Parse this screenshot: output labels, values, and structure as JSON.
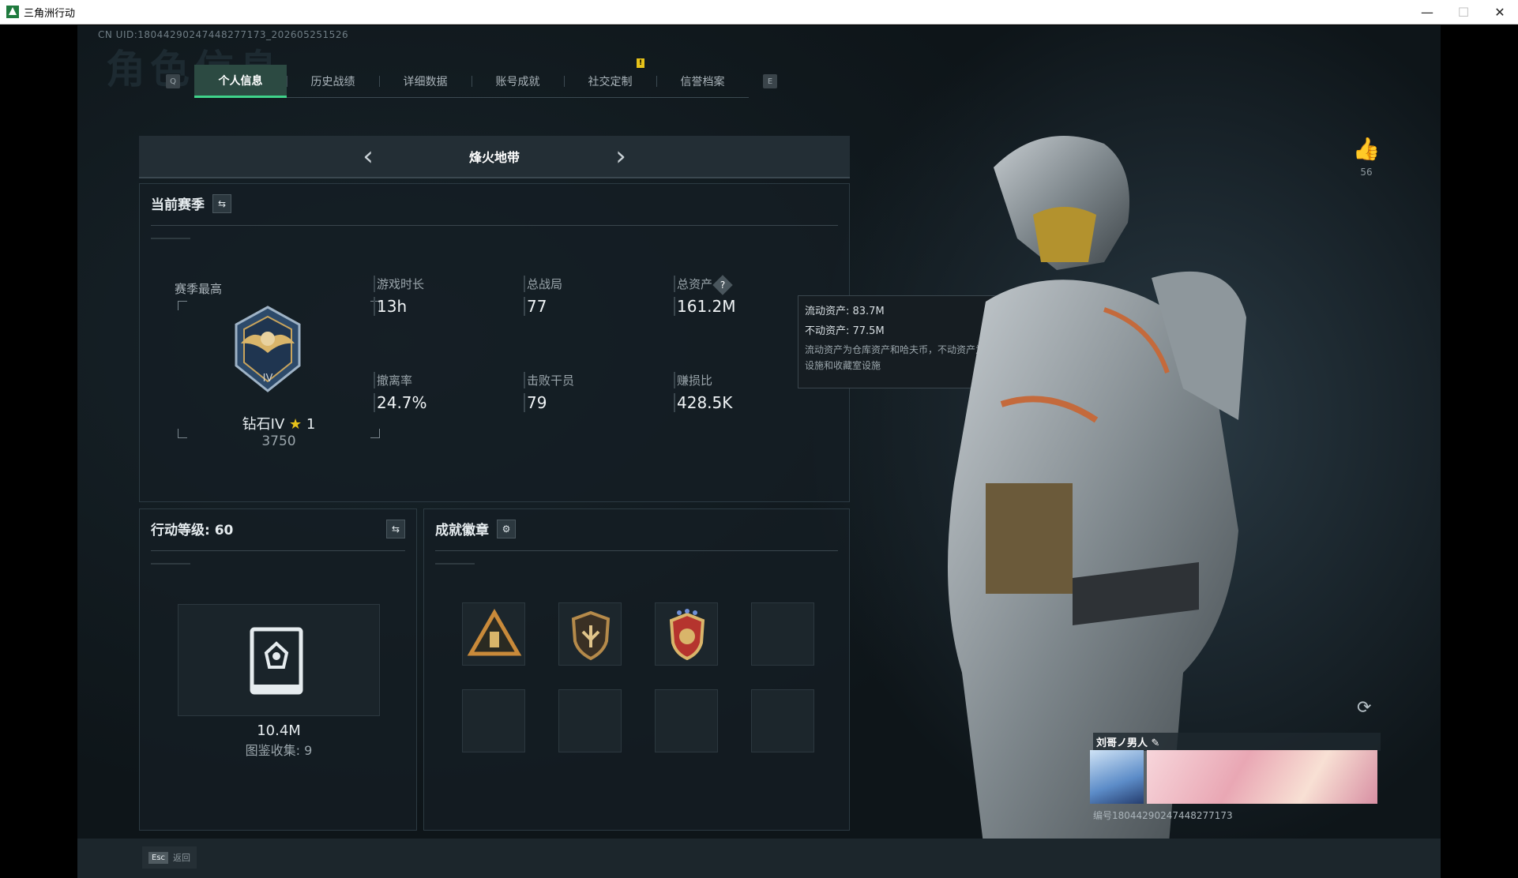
{
  "window": {
    "title": "三角洲行动",
    "min": "—",
    "max": "☐",
    "close": "✕"
  },
  "uid_text": "CN UID:18044290247448277173_202605251526",
  "bg_title": "角色信息",
  "tabs": {
    "left_key": "Q",
    "right_key": "E",
    "notify_mark": "!",
    "items": [
      "个人信息",
      "历史战绩",
      "详细数据",
      "账号成就",
      "社交定制",
      "信誉档案"
    ]
  },
  "mode": {
    "name": "烽火地带",
    "prev": "‹",
    "next": "›"
  },
  "season": {
    "title": "当前赛季",
    "swap_icon": "⇆",
    "best_label": "赛季最高",
    "rank_name": "钻石IV",
    "rank_star_icon": "★",
    "rank_stars": "1",
    "rank_score": "3750",
    "stats": [
      {
        "label": "游戏时长",
        "value": "13h"
      },
      {
        "label": "总战局",
        "value": "77"
      },
      {
        "label": "总资产",
        "value": "161.2M"
      },
      {
        "label": "撤离率",
        "value": "24.7%"
      },
      {
        "label": "击败干员",
        "value": "79"
      },
      {
        "label": "赚损比",
        "value": "428.5K"
      }
    ],
    "help_icon": "?"
  },
  "tooltip": {
    "liquid": "流动资产: 83.7M",
    "fixed": "不动资产: 77.5M",
    "desc": "流动资产为仓库资产和哈夫币，不动资产为特勤处设施和收藏室设施"
  },
  "level": {
    "title": "行动等级: 60",
    "swap_icon": "⇆",
    "codex_value": "10.4M",
    "codex_count": "图鉴收集: 9"
  },
  "badges": {
    "title": "成就徽章",
    "gear_icon": "⚙"
  },
  "footer": {
    "esc_key": "Esc",
    "esc_label": "返回"
  },
  "profile": {
    "like_icon": "👍",
    "like_count": "56",
    "refresh_icon": "⟳",
    "name": "刘哥ノ男人",
    "edit_icon": "✎",
    "id": "编号18044290247448277173"
  },
  "colors": {
    "accent": "#3fd38a",
    "notify": "#e6c21a",
    "bg": "#121b20"
  }
}
